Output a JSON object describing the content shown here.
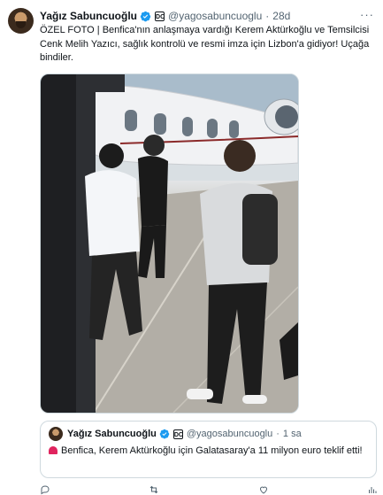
{
  "tweet": {
    "author_name": "Yağız Sabuncuoğlu",
    "handle": "@yagosabuncuoglu",
    "separator": "·",
    "time": "28d",
    "badge": "DC",
    "text": "ÖZEL FOTO | Benfica'nın anlaşmaya vardığı Kerem Aktürkoğlu ve Temsilcisi Cenk Melih Yazıcı, sağlık kontrolü ve resmi imza için Lizbon'a gidiyor! Uçağa bindiler.",
    "more_label": "···"
  },
  "quote": {
    "author_name": "Yağız Sabuncuoğlu",
    "handle": "@yagosabuncuoglu",
    "separator": "·",
    "time": "1 sa",
    "badge": "DC",
    "text": "Benfica, Kerem Aktürkoğlu için Galatasaray'a 11 milyon euro teklif etti!"
  },
  "colors": {
    "accent": "#1d9bf0",
    "muted": "#536471",
    "border": "#cfd9de"
  },
  "icons": [
    "more-icon",
    "verified-icon",
    "reply-icon",
    "retweet-icon",
    "like-icon",
    "views-icon",
    "alarm-icon"
  ]
}
